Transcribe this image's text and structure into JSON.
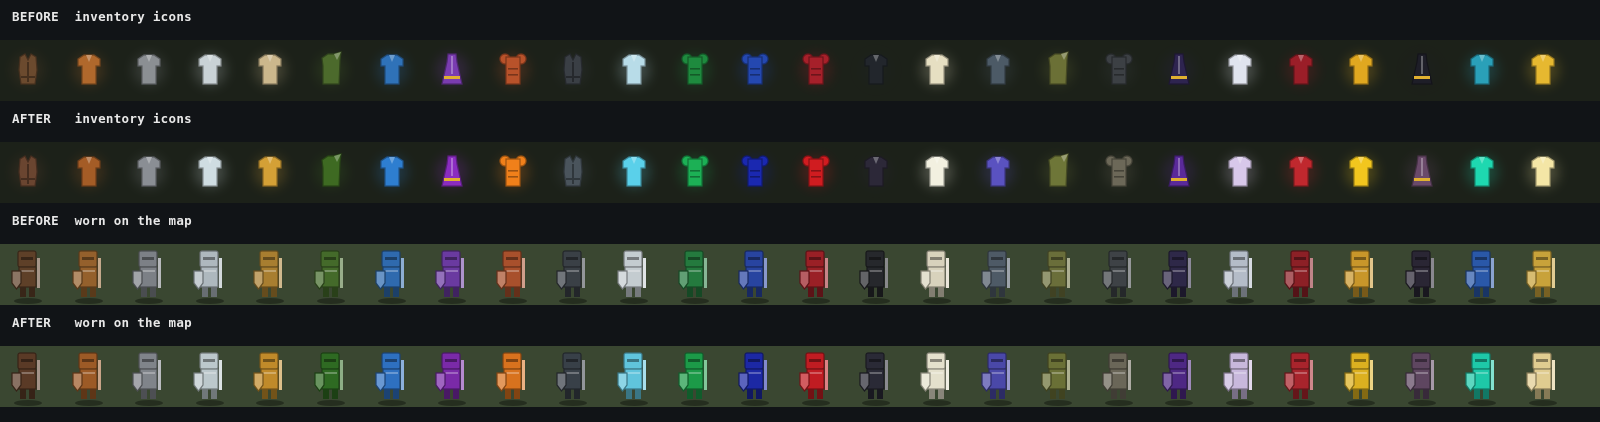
{
  "sections": [
    {
      "label": "BEFORE  inventory icons",
      "kind": "icons",
      "items": [
        {
          "name": "leather-vest",
          "shape": "vest",
          "color": "#6b4a2e"
        },
        {
          "name": "bronze-chain",
          "shape": "shirt",
          "color": "#b0682c"
        },
        {
          "name": "iron-chain",
          "shape": "shirt",
          "color": "#8b8f93"
        },
        {
          "name": "steel-plate",
          "shape": "shirt",
          "color": "#c9d2d6"
        },
        {
          "name": "canvas-tunic",
          "shape": "shirt",
          "color": "#cbb78c"
        },
        {
          "name": "moss-cloak",
          "shape": "cloak",
          "color": "#4c6a2c"
        },
        {
          "name": "blue-tunic",
          "shape": "shirt",
          "color": "#2f72b8"
        },
        {
          "name": "purple-robe",
          "shape": "robe",
          "color": "#7a3cb0"
        },
        {
          "name": "copper-plate",
          "shape": "puff",
          "color": "#b8522a"
        },
        {
          "name": "black-iron",
          "shape": "vest",
          "color": "#3a3f45"
        },
        {
          "name": "frost-mail",
          "shape": "shirt",
          "color": "#b8dce8"
        },
        {
          "name": "emerald-plate",
          "shape": "puff",
          "color": "#1e8a3e"
        },
        {
          "name": "sapphire-plate",
          "shape": "puff",
          "color": "#2448b0"
        },
        {
          "name": "crimson-plate",
          "shape": "puff",
          "color": "#a6202a"
        },
        {
          "name": "shadow-tunic",
          "shape": "shirt",
          "color": "#22262c"
        },
        {
          "name": "ivory-tunic",
          "shape": "shirt",
          "color": "#e6dfc2"
        },
        {
          "name": "slate-mail",
          "shape": "shirt",
          "color": "#4c5a66"
        },
        {
          "name": "olive-cloak",
          "shape": "cloak",
          "color": "#6b7036"
        },
        {
          "name": "obsidian-plate",
          "shape": "puff",
          "color": "#3c4044"
        },
        {
          "name": "void-robe",
          "shape": "robe",
          "color": "#2e2450"
        },
        {
          "name": "silver-tunic",
          "shape": "shirt",
          "color": "#e0e4ee"
        },
        {
          "name": "ruby-tunic",
          "shape": "shirt",
          "color": "#9a1e28"
        },
        {
          "name": "gold-tunic",
          "shape": "shirt",
          "color": "#e0a820"
        },
        {
          "name": "dark-robe",
          "shape": "robe",
          "color": "#1e1e28"
        },
        {
          "name": "teal-tunic",
          "shape": "shirt",
          "color": "#2aa0b8"
        },
        {
          "name": "sun-tunic",
          "shape": "shirt",
          "color": "#e6b830"
        }
      ]
    },
    {
      "label": "AFTER   inventory icons",
      "kind": "icons",
      "items": [
        {
          "name": "leather-vest",
          "shape": "vest",
          "color": "#6a4530"
        },
        {
          "name": "bronze-chain",
          "shape": "shirt",
          "color": "#a45c26"
        },
        {
          "name": "iron-chain",
          "shape": "shirt",
          "color": "#8a8e94"
        },
        {
          "name": "steel-plate",
          "shape": "shirt",
          "color": "#cfdde2"
        },
        {
          "name": "canvas-tunic",
          "shape": "shirt",
          "color": "#d4a036"
        },
        {
          "name": "moss-cloak",
          "shape": "cloak",
          "color": "#3e6a22"
        },
        {
          "name": "blue-tunic",
          "shape": "shirt",
          "color": "#2e7ed0"
        },
        {
          "name": "purple-robe",
          "shape": "robe",
          "color": "#8a2cc0"
        },
        {
          "name": "copper-plate",
          "shape": "puff",
          "color": "#f0801a"
        },
        {
          "name": "black-iron",
          "shape": "vest",
          "color": "#4a545c"
        },
        {
          "name": "frost-mail",
          "shape": "shirt",
          "color": "#5ad0ea"
        },
        {
          "name": "emerald-plate",
          "shape": "puff",
          "color": "#1cb055"
        },
        {
          "name": "sapphire-plate",
          "shape": "puff",
          "color": "#1a28b0"
        },
        {
          "name": "crimson-plate",
          "shape": "puff",
          "color": "#d01c20"
        },
        {
          "name": "shadow-tunic",
          "shape": "shirt",
          "color": "#2c2838"
        },
        {
          "name": "ivory-tunic",
          "shape": "shirt",
          "color": "#f2f0e0"
        },
        {
          "name": "slate-mail",
          "shape": "shirt",
          "color": "#5a52c0"
        },
        {
          "name": "olive-cloak",
          "shape": "cloak",
          "color": "#6e7638"
        },
        {
          "name": "obsidian-plate",
          "shape": "puff",
          "color": "#6c6858"
        },
        {
          "name": "void-robe",
          "shape": "robe",
          "color": "#5a2a9a"
        },
        {
          "name": "silver-tunic",
          "shape": "shirt",
          "color": "#d8c8ea"
        },
        {
          "name": "ruby-tunic",
          "shape": "shirt",
          "color": "#c0282e"
        },
        {
          "name": "gold-tunic",
          "shape": "shirt",
          "color": "#f2c61e"
        },
        {
          "name": "dark-robe",
          "shape": "robe",
          "color": "#6a4a6a"
        },
        {
          "name": "teal-tunic",
          "shape": "shirt",
          "color": "#1ed8b0"
        },
        {
          "name": "sun-tunic",
          "shape": "shirt",
          "color": "#f4e6a6"
        }
      ]
    },
    {
      "label": "BEFORE  worn on the map",
      "kind": "map",
      "items": [
        {
          "name": "leather",
          "color": "#5e4028"
        },
        {
          "name": "bronze",
          "color": "#94602c"
        },
        {
          "name": "iron",
          "color": "#7c8086"
        },
        {
          "name": "steel",
          "color": "#aeb8be"
        },
        {
          "name": "canvas",
          "color": "#a87e30"
        },
        {
          "name": "moss",
          "color": "#446a2a"
        },
        {
          "name": "blue",
          "color": "#2f6aae"
        },
        {
          "name": "purple",
          "color": "#6a3aa0"
        },
        {
          "name": "copper",
          "color": "#a8502c"
        },
        {
          "name": "black-iron",
          "color": "#3a4046"
        },
        {
          "name": "frost",
          "color": "#c4ccd0"
        },
        {
          "name": "emerald",
          "color": "#247a3e"
        },
        {
          "name": "sapphire",
          "color": "#2844a0"
        },
        {
          "name": "crimson",
          "color": "#9a2026"
        },
        {
          "name": "shadow",
          "color": "#26282c"
        },
        {
          "name": "ivory",
          "color": "#d8d2bc"
        },
        {
          "name": "slate",
          "color": "#4e5a66"
        },
        {
          "name": "olive",
          "color": "#6a6e3a"
        },
        {
          "name": "obsidian",
          "color": "#3e4246"
        },
        {
          "name": "void",
          "color": "#2e2848"
        },
        {
          "name": "silver",
          "color": "#b4bcc8"
        },
        {
          "name": "ruby",
          "color": "#8c2026"
        },
        {
          "name": "gold",
          "color": "#c8962a"
        },
        {
          "name": "dark",
          "color": "#2a2634"
        },
        {
          "name": "teal",
          "color": "#2a58a8"
        },
        {
          "name": "sun",
          "color": "#c8a23a"
        }
      ]
    },
    {
      "label": "AFTER   worn on the map",
      "kind": "map",
      "items": [
        {
          "name": "leather",
          "color": "#5a3a26"
        },
        {
          "name": "bronze",
          "color": "#9c5a26"
        },
        {
          "name": "iron",
          "color": "#80848a"
        },
        {
          "name": "steel",
          "color": "#bcc8cc"
        },
        {
          "name": "canvas",
          "color": "#c08a2a"
        },
        {
          "name": "moss",
          "color": "#2e6a22"
        },
        {
          "name": "blue",
          "color": "#2e70c0"
        },
        {
          "name": "purple",
          "color": "#7a2aa8"
        },
        {
          "name": "copper",
          "color": "#d8721e"
        },
        {
          "name": "black-iron",
          "color": "#384048"
        },
        {
          "name": "frost",
          "color": "#60c4dc"
        },
        {
          "name": "emerald",
          "color": "#1c9a48"
        },
        {
          "name": "sapphire",
          "color": "#1c28a4"
        },
        {
          "name": "crimson",
          "color": "#c01c22"
        },
        {
          "name": "shadow",
          "color": "#2a2a36"
        },
        {
          "name": "ivory",
          "color": "#e4e0cc"
        },
        {
          "name": "slate",
          "color": "#4a48a8"
        },
        {
          "name": "olive",
          "color": "#6a7036"
        },
        {
          "name": "obsidian",
          "color": "#6a6658"
        },
        {
          "name": "void",
          "color": "#4e2884"
        },
        {
          "name": "silver",
          "color": "#c8b8dc"
        },
        {
          "name": "ruby",
          "color": "#a8242c"
        },
        {
          "name": "gold",
          "color": "#dcb020"
        },
        {
          "name": "dark",
          "color": "#5e4660"
        },
        {
          "name": "teal",
          "color": "#1ec8a8"
        },
        {
          "name": "sun",
          "color": "#e0cc90"
        }
      ]
    }
  ]
}
